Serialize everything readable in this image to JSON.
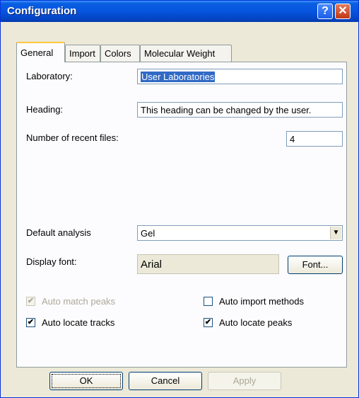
{
  "window": {
    "title": "Configuration",
    "help_glyph": "?",
    "close_glyph": "✕"
  },
  "tabs": [
    {
      "label": "General",
      "active": true
    },
    {
      "label": "Import",
      "active": false
    },
    {
      "label": "Colors",
      "active": false
    },
    {
      "label": "Molecular Weight",
      "active": false
    }
  ],
  "general": {
    "laboratory": {
      "label": "Laboratory:",
      "value": "User Laboratories"
    },
    "heading": {
      "label": "Heading:",
      "value": "This heading can be changed by the user."
    },
    "recent_files": {
      "label": "Number of recent files:",
      "value": "4"
    },
    "default_analysis": {
      "label": "Default analysis",
      "value": "Gel",
      "arrow_glyph": "▼"
    },
    "display_font": {
      "label": "Display font:",
      "value": "Arial",
      "button": "Font..."
    },
    "checkboxes": {
      "auto_match_peaks": {
        "label": "Auto match peaks",
        "checked": true,
        "disabled": true
      },
      "auto_import_methods": {
        "label": "Auto import methods",
        "checked": false
      },
      "auto_locate_tracks": {
        "label": "Auto locate tracks",
        "checked": true
      },
      "auto_locate_peaks": {
        "label": "Auto locate peaks",
        "checked": true
      }
    },
    "check_glyph": "✔"
  },
  "footer": {
    "ok": "OK",
    "cancel": "Cancel",
    "apply": "Apply"
  },
  "colors": {
    "title_bar": "#0655df",
    "face": "#ece9d8",
    "selection": "#316ac5",
    "tab_highlight": "#ffc83c"
  }
}
